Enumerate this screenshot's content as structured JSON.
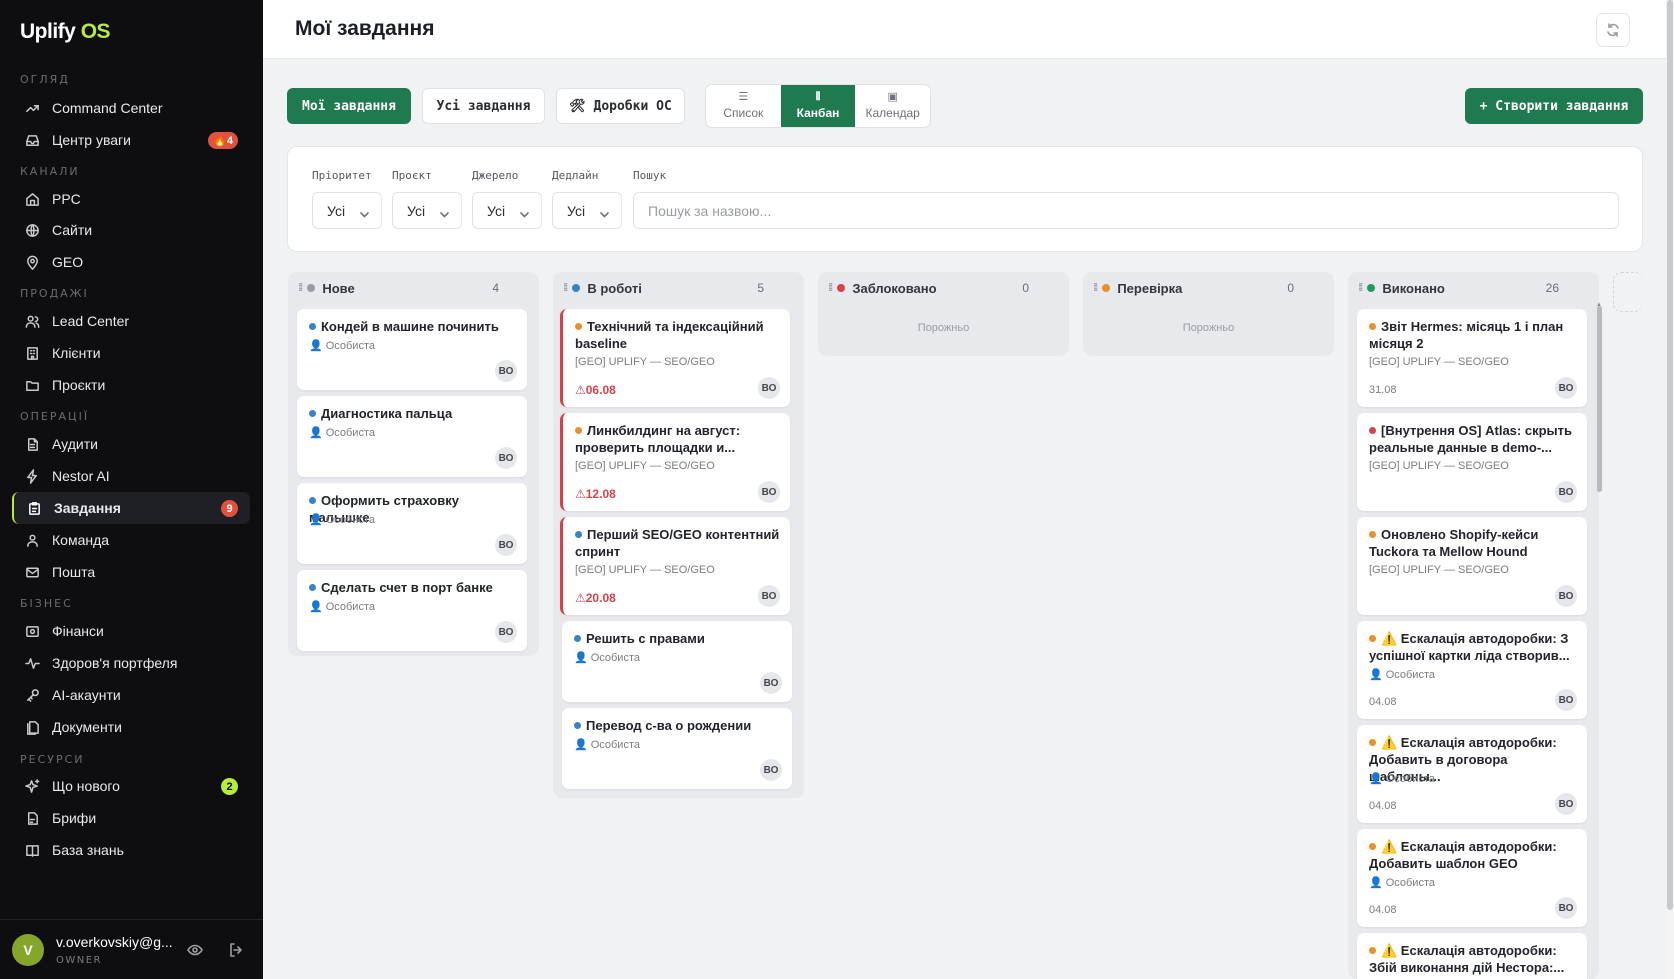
{
  "sidebar": {
    "logo_main": "Uplify",
    "logo_accent": "OS",
    "sections": {
      "overview": "ОГЛЯД",
      "channels": "КАНАЛИ",
      "sales": "ПРОДАЖІ",
      "operations": "ОПЕРАЦІЇ",
      "business": "БІЗНЕС",
      "resources": "РЕСУРСИ"
    },
    "items": {
      "command_center": "Command Center",
      "attention": "Центр уваги",
      "attention_badge": "🔥4",
      "ppc": "PPC",
      "sites": "Сайти",
      "geo": "GEO",
      "lead_center": "Lead Center",
      "clients": "Клієнти",
      "projects": "Проєкти",
      "audits": "Аудити",
      "nestor": "Nestor AI",
      "tasks": "Завдання",
      "tasks_badge": "9",
      "team": "Команда",
      "mail": "Пошта",
      "finance": "Фінанси",
      "portfolio": "Здоров'я портфеля",
      "ai_accounts": "AI-акаунти",
      "documents": "Документи",
      "whats_new": "Що нового",
      "whats_new_badge": "2",
      "briefs": "Брифи",
      "knowledge": "База знань"
    },
    "user": {
      "avatar": "V",
      "email": "v.overkovskiy@g...",
      "role": "OWNER"
    }
  },
  "header": {
    "title": "Мої завдання"
  },
  "toolbar": {
    "my_tasks": "Мої завдання",
    "all_tasks": "Усі завдання",
    "os_tweaks": "🛠 Доробки ОС",
    "views": {
      "list": "Список",
      "kanban": "Канбан",
      "calendar": "Календар"
    },
    "create": "+ Створити завдання"
  },
  "filters": {
    "priority_label": "Пріоритет",
    "priority_value": "Усі",
    "project_label": "Проєкт",
    "project_value": "Усі",
    "source_label": "Джерело",
    "source_value": "Усі",
    "deadline_label": "Дедлайн",
    "deadline_value": "Усі",
    "search_label": "Пошук",
    "search_placeholder": "Пошук за назвою..."
  },
  "colors": {
    "accent": "#1f7a4f",
    "lime": "#b6ec3a",
    "priority_blue": "#3b82c4",
    "priority_orange": "#e8902a",
    "priority_red": "#d6424a",
    "overdue": "#d6424a"
  },
  "kanban": {
    "columns": [
      {
        "title": "Нове",
        "count": "4",
        "dot": "#9a9ca3",
        "cards": [
          {
            "title": "Кондей в машине починить",
            "meta": "Особиста",
            "priority": "#3b82c4",
            "avatar": "ВО"
          },
          {
            "title": "Диагностика пальца",
            "meta": "Особиста",
            "priority": "#3b82c4",
            "avatar": "ВО"
          },
          {
            "title": "Оформить страховку малышке",
            "meta": "Особиста",
            "priority": "#3b82c4",
            "avatar": "ВО"
          },
          {
            "title": "Сделать счет в порт банке",
            "meta": "Особиста",
            "priority": "#3b82c4",
            "avatar": "ВО"
          }
        ]
      },
      {
        "title": "В роботі",
        "count": "5",
        "dot": "#3b82c4",
        "cards": [
          {
            "title": "Технічний та індексаційний baseline",
            "meta": "[GEO] UPLIFY — SEO/GEO",
            "priority": "#e8902a",
            "due": "⚠06.08",
            "avatar": "ВО"
          },
          {
            "title": "Линкбилдинг на август: проверить площадки и...",
            "meta": "[GEO] UPLIFY — SEO/GEO",
            "priority": "#e8902a",
            "due": "⚠12.08",
            "avatar": "ВО"
          },
          {
            "title": "Перший SEO/GEO контентний спринт",
            "meta": "[GEO] UPLIFY — SEO/GEO",
            "priority": "#3b82c4",
            "due": "⚠20.08",
            "avatar": "ВО"
          },
          {
            "title": "Решить с правами",
            "meta": "Особиста",
            "priority": "#3b82c4",
            "avatar": "ВО"
          },
          {
            "title": "Перевод с-ва о рождении",
            "meta": "Особиста",
            "priority": "#3b82c4",
            "avatar": "ВО"
          }
        ]
      },
      {
        "title": "Заблоковано",
        "count": "0",
        "dot": "#d6424a",
        "empty": "Порожньо",
        "cards": []
      },
      {
        "title": "Перевірка",
        "count": "0",
        "dot": "#e8902a",
        "empty": "Порожньо",
        "cards": []
      },
      {
        "title": "Виконано",
        "count": "26",
        "dot": "#1f9a5f",
        "cards": [
          {
            "title": "Звіт Hermes: місяць 1 і план місяця 2",
            "meta": "[GEO] UPLIFY — SEO/GEO",
            "priority": "#e8902a",
            "date": "31.08",
            "avatar": "ВО"
          },
          {
            "title": "[Внутрення OS] Atlas: скрыть реальные данные в demo-...",
            "meta": "[GEO] UPLIFY — SEO/GEO",
            "priority": "#d6424a",
            "avatar": "ВО"
          },
          {
            "title": "Оновлено Shopify-кейси Tuckora та Mellow Hound",
            "meta": "[GEO] UPLIFY — SEO/GEO",
            "priority": "#e8902a",
            "avatar": "ВО"
          },
          {
            "title": "⚠️ Ескалація автодоробки: З успішної картки ліда створив...",
            "meta": "Особиста",
            "priority": "#e8902a",
            "date": "04.08",
            "avatar": "ВО"
          },
          {
            "title": "⚠️ Ескалація автодоробки: Добавить в договора шаблоны...",
            "meta": "Особиста",
            "priority": "#e8902a",
            "date": "04.08",
            "avatar": "ВО"
          },
          {
            "title": "⚠️ Ескалація автодоробки: Добавить шаблон GEO",
            "meta": "Особиста",
            "priority": "#e8902a",
            "date": "04.08",
            "avatar": "ВО"
          },
          {
            "title": "⚠️ Ескалація автодоробки: Збій виконання дій Нестора:...",
            "meta": "",
            "priority": "#e8902a",
            "avatar": ""
          }
        ]
      }
    ]
  }
}
